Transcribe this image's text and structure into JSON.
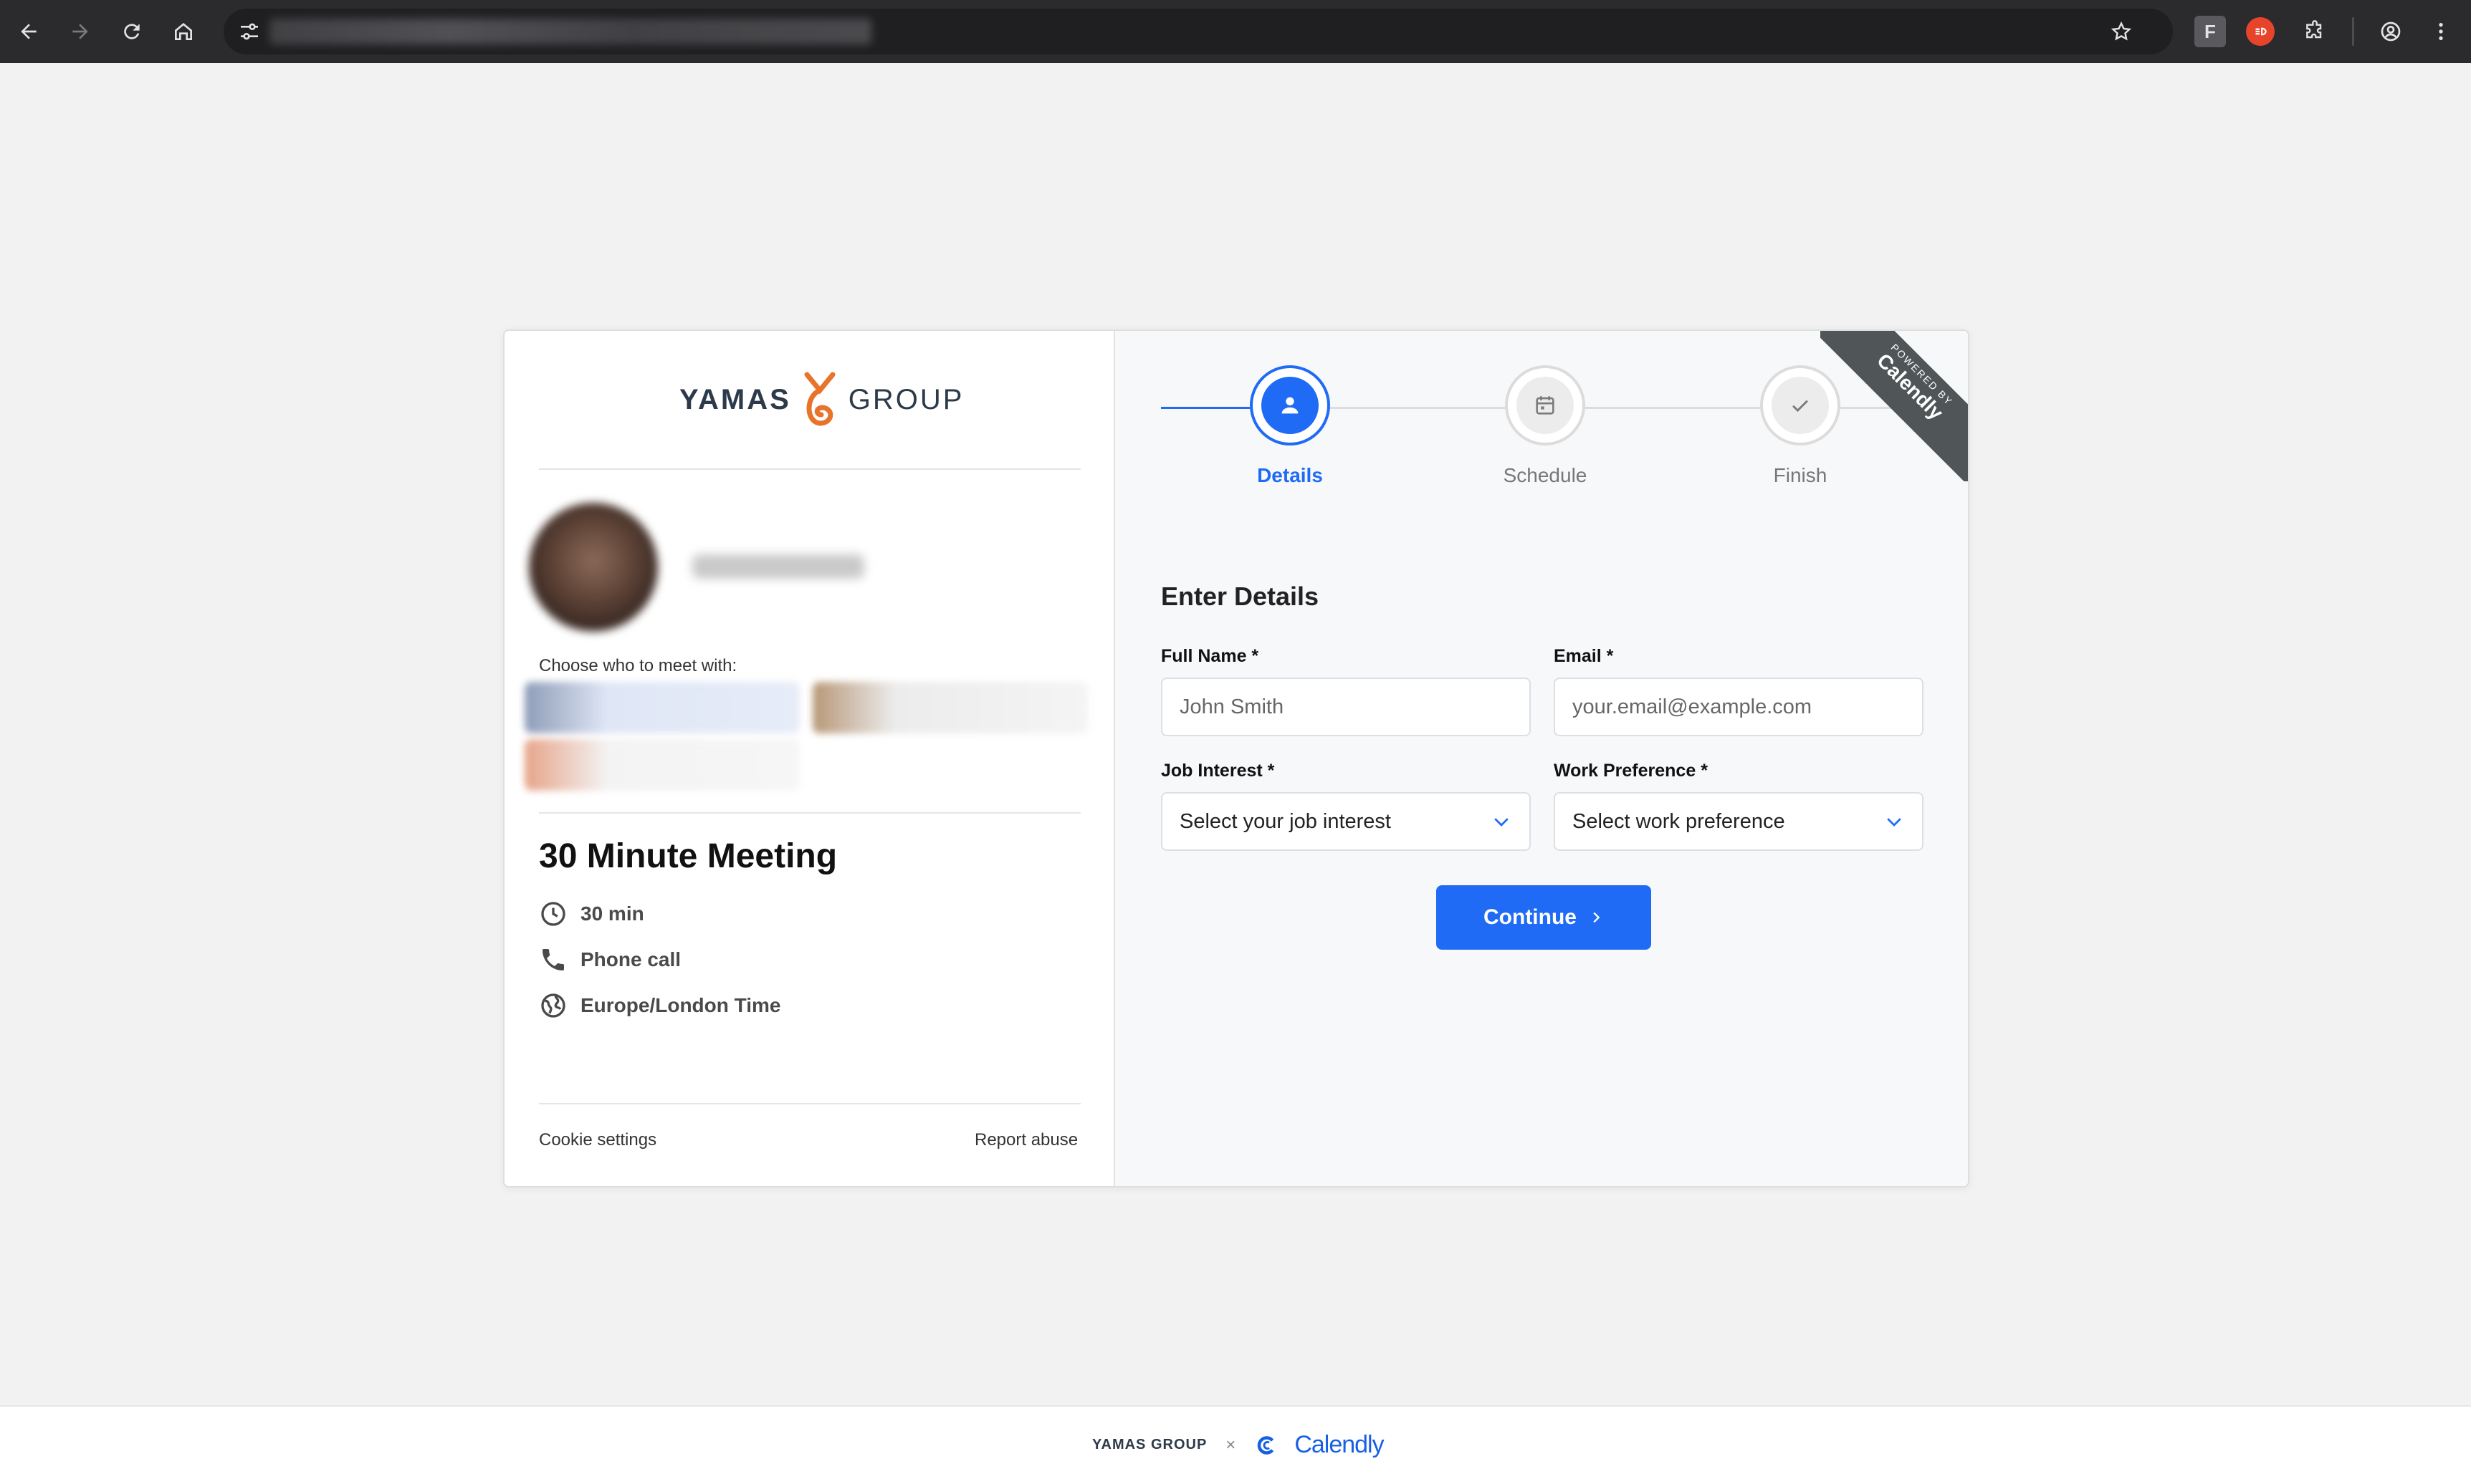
{
  "brand": {
    "yamas_left": "YAMAS",
    "yamas_right": "GROUP",
    "accent_orange": "#e8742c",
    "calendly_blue": "#1760e6",
    "primary_blue": "#1f6bf5"
  },
  "left_panel": {
    "choose_label": "Choose who to meet with:",
    "meeting_title": "30 Minute Meeting",
    "meta": {
      "duration": "30 min",
      "location": "Phone call",
      "timezone": "Europe/London Time"
    },
    "footer": {
      "cookie_settings": "Cookie settings",
      "report_abuse": "Report abuse"
    }
  },
  "ribbon": {
    "small": "POWERED BY",
    "big": "Calendly"
  },
  "stepper": {
    "steps": [
      {
        "label": "Details"
      },
      {
        "label": "Schedule"
      },
      {
        "label": "Finish"
      }
    ]
  },
  "form": {
    "title": "Enter Details",
    "full_name": {
      "label": "Full Name *",
      "placeholder": "John Smith"
    },
    "email": {
      "label": "Email *",
      "placeholder": "your.email@example.com"
    },
    "job_interest": {
      "label": "Job Interest *",
      "value": "Select your job interest"
    },
    "work_preference": {
      "label": "Work Preference *",
      "value": "Select work preference"
    },
    "continue_label": "Continue"
  },
  "bottom_bar": {
    "yamas": "YAMAS GROUP",
    "separator": "×",
    "calendly": "Calendly"
  },
  "chrome": {
    "extension_f": "F"
  }
}
